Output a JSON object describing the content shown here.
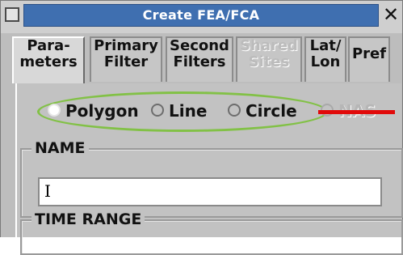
{
  "window": {
    "title": "Create FEA/FCA",
    "close_glyph": "✕"
  },
  "tabs": [
    {
      "line1": "Para-",
      "line2": "meters",
      "state": "active"
    },
    {
      "line1": "Primary",
      "line2": "Filter",
      "state": "normal"
    },
    {
      "line1": "Second",
      "line2": "Filters",
      "state": "normal"
    },
    {
      "line1": "Shared",
      "line2": "Sites",
      "state": "disabled"
    },
    {
      "line1": "Lat/",
      "line2": "Lon",
      "state": "normal"
    },
    {
      "line1": "Pref",
      "line2": "",
      "state": "normal"
    }
  ],
  "shape_options": {
    "selected": "Polygon",
    "items": [
      {
        "label": "Polygon"
      },
      {
        "label": "Line"
      },
      {
        "label": "Circle"
      },
      {
        "label": "NAS"
      }
    ]
  },
  "name_group": {
    "label": "NAME",
    "value": "I"
  },
  "time_range_group": {
    "label": "TIME RANGE"
  },
  "annotation_colors": {
    "highlight_ellipse": "#82c146",
    "strike_bar": "#e10a0a"
  }
}
